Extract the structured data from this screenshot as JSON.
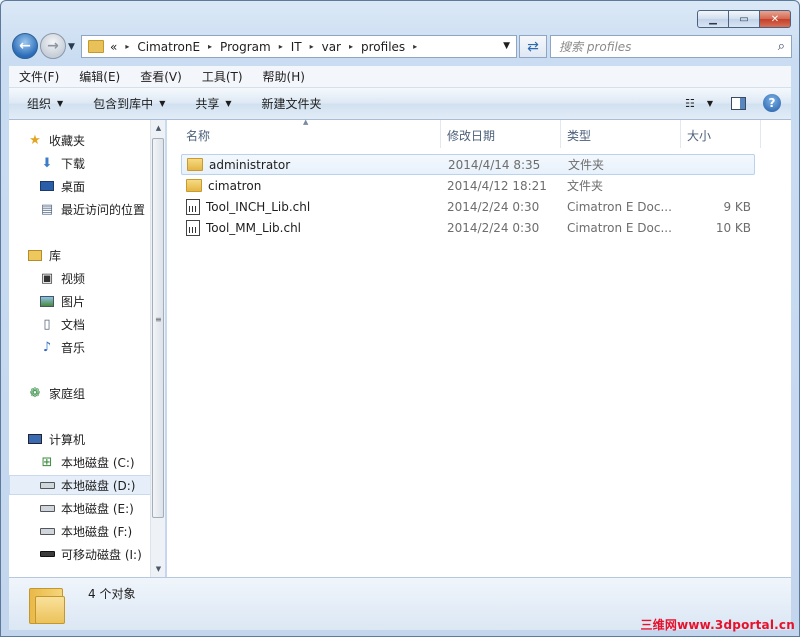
{
  "address": {
    "crumbs": [
      "«",
      "CimatronE",
      "Program",
      "IT",
      "var",
      "profiles"
    ],
    "search_placeholder": "搜索 profiles"
  },
  "menu": [
    "文件(F)",
    "编辑(E)",
    "查看(V)",
    "工具(T)",
    "帮助(H)"
  ],
  "toolbar": {
    "organize": "组织",
    "include_library": "包含到库中",
    "share": "共享",
    "new_folder": "新建文件夹"
  },
  "nav": {
    "favorites": "收藏夹",
    "downloads": "下载",
    "desktop": "桌面",
    "recent": "最近访问的位置",
    "libraries": "库",
    "videos": "视频",
    "pictures": "图片",
    "documents": "文档",
    "music": "音乐",
    "homegroup": "家庭组",
    "computer": "计算机",
    "drive_c": "本地磁盘 (C:)",
    "drive_d": "本地磁盘 (D:)",
    "drive_e": "本地磁盘 (E:)",
    "drive_f": "本地磁盘 (F:)",
    "drive_i": "可移动磁盘 (I:)"
  },
  "columns": {
    "name": "名称",
    "date": "修改日期",
    "type": "类型",
    "size": "大小"
  },
  "files": [
    {
      "name": "administrator",
      "date": "2014/4/14 8:35",
      "type": "文件夹",
      "size": "",
      "icon": "folder"
    },
    {
      "name": "cimatron",
      "date": "2014/4/12 18:21",
      "type": "文件夹",
      "size": "",
      "icon": "folder"
    },
    {
      "name": "Tool_INCH_Lib.chl",
      "date": "2014/2/24 0:30",
      "type": "Cimatron E Doc...",
      "size": "9 KB",
      "icon": "doc"
    },
    {
      "name": "Tool_MM_Lib.chl",
      "date": "2014/2/24 0:30",
      "type": "Cimatron E Doc...",
      "size": "10 KB",
      "icon": "doc"
    }
  ],
  "status": {
    "count": "4 个对象"
  },
  "watermark": "三维网www.3dportal.cn"
}
